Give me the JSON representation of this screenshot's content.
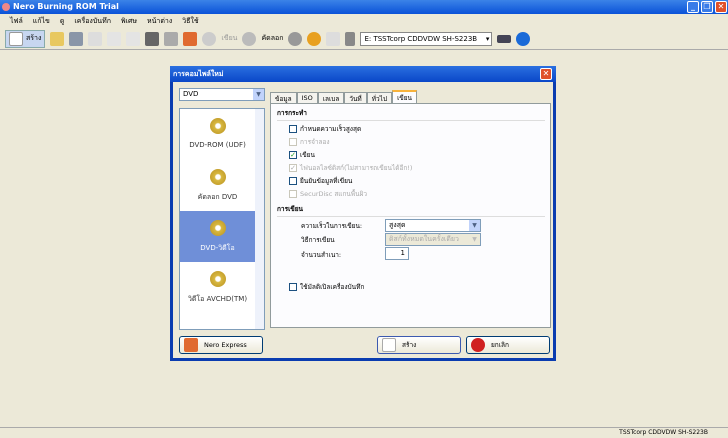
{
  "app": {
    "title": "Nero Burning ROM Trial"
  },
  "menu": [
    "ไฟล์",
    "แก้ไข",
    "ดู",
    "เครื่องบันทึก",
    "พิเศษ",
    "หน้าต่าง",
    "วิธีใช้"
  ],
  "toolbar": {
    "new_label": "สร้าง",
    "burn_label": "เขียน",
    "copy_label": "คัดลอก",
    "drive": "E: TSSTcorp CDDVDW SH-S223B"
  },
  "status": {
    "drive": "TSSTcorp CDDVDW SH-S223B"
  },
  "dialog": {
    "title": "การคอมไพล์ใหม่",
    "disc_type": "DVD",
    "projects": [
      {
        "label": "DVD-ROM (UDF)"
      },
      {
        "label": "คัดลอก DVD"
      },
      {
        "label": "DVD-วิดีโอ"
      },
      {
        "label": "วิดีโอ AVCHD(TM)"
      }
    ],
    "tabs": [
      "ข้อมูล",
      "ISO",
      "เลเบล",
      "วันที่",
      "ทั่วไป",
      "เขียน"
    ],
    "action_section": "การกระทำ",
    "options": [
      {
        "label": "กำหนดความเร็วสูงสุด",
        "checked": false,
        "enabled": true
      },
      {
        "label": "การจำลอง",
        "checked": false,
        "enabled": false
      },
      {
        "label": "เขียน",
        "checked": true,
        "enabled": true
      },
      {
        "label": "ไฟนอลไลซ์ดิสก์(ไม่สามารถเขียนได้อีก!)",
        "checked": true,
        "enabled": false
      },
      {
        "label": "ยืนยันข้อมูลที่เขียน",
        "checked": false,
        "enabled": true
      },
      {
        "label": "SecurDisc สแกนพื้นผิว",
        "checked": false,
        "enabled": false
      }
    ],
    "write_section": "การเขียน",
    "speed_label": "ความเร็วในการเขียน:",
    "speed_value": "สูงสุด",
    "method_label": "วิธีการเขียน",
    "method_value": "ดิสก์ทั้งหมดในครั้งเดียว",
    "copies_label": "จำนวนสำเนา:",
    "copies_value": "1",
    "multi_label": "ใช้มัลติเปิลเครื่องบันทึก",
    "nero_express": "Nero Express",
    "new_button": "สร้าง",
    "cancel_button": "ยกเลิก"
  }
}
